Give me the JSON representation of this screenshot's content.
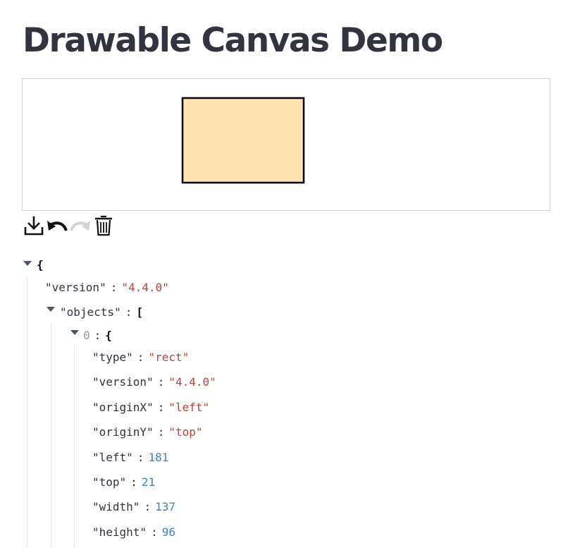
{
  "page": {
    "title": "Drawable Canvas Demo"
  },
  "canvas": {
    "background_color": "#ffffff",
    "shape": {
      "type": "rect",
      "fill": "#ffe3b0",
      "stroke": "#000000"
    }
  },
  "toolbar": {
    "items": [
      {
        "icon": "download-icon",
        "enabled": true
      },
      {
        "icon": "undo-icon",
        "enabled": true
      },
      {
        "icon": "redo-icon",
        "enabled": false
      },
      {
        "icon": "trash-icon",
        "enabled": true
      }
    ]
  },
  "json_view": {
    "root_open": "{",
    "version_key": "\"version\"",
    "version_value": "\"4.4.0\"",
    "objects_key": "\"objects\"",
    "objects_open": "[",
    "item_index": "0",
    "item_open": "{",
    "colon": ":",
    "fields": [
      {
        "key": "\"type\"",
        "value": "\"rect\"",
        "kind": "string"
      },
      {
        "key": "\"version\"",
        "value": "\"4.4.0\"",
        "kind": "string"
      },
      {
        "key": "\"originX\"",
        "value": "\"left\"",
        "kind": "string"
      },
      {
        "key": "\"originY\"",
        "value": "\"top\"",
        "kind": "string"
      },
      {
        "key": "\"left\"",
        "value": "181",
        "kind": "number"
      },
      {
        "key": "\"top\"",
        "value": "21",
        "kind": "number"
      },
      {
        "key": "\"width\"",
        "value": "137",
        "kind": "number"
      },
      {
        "key": "\"height\"",
        "value": "96",
        "kind": "number"
      }
    ]
  }
}
